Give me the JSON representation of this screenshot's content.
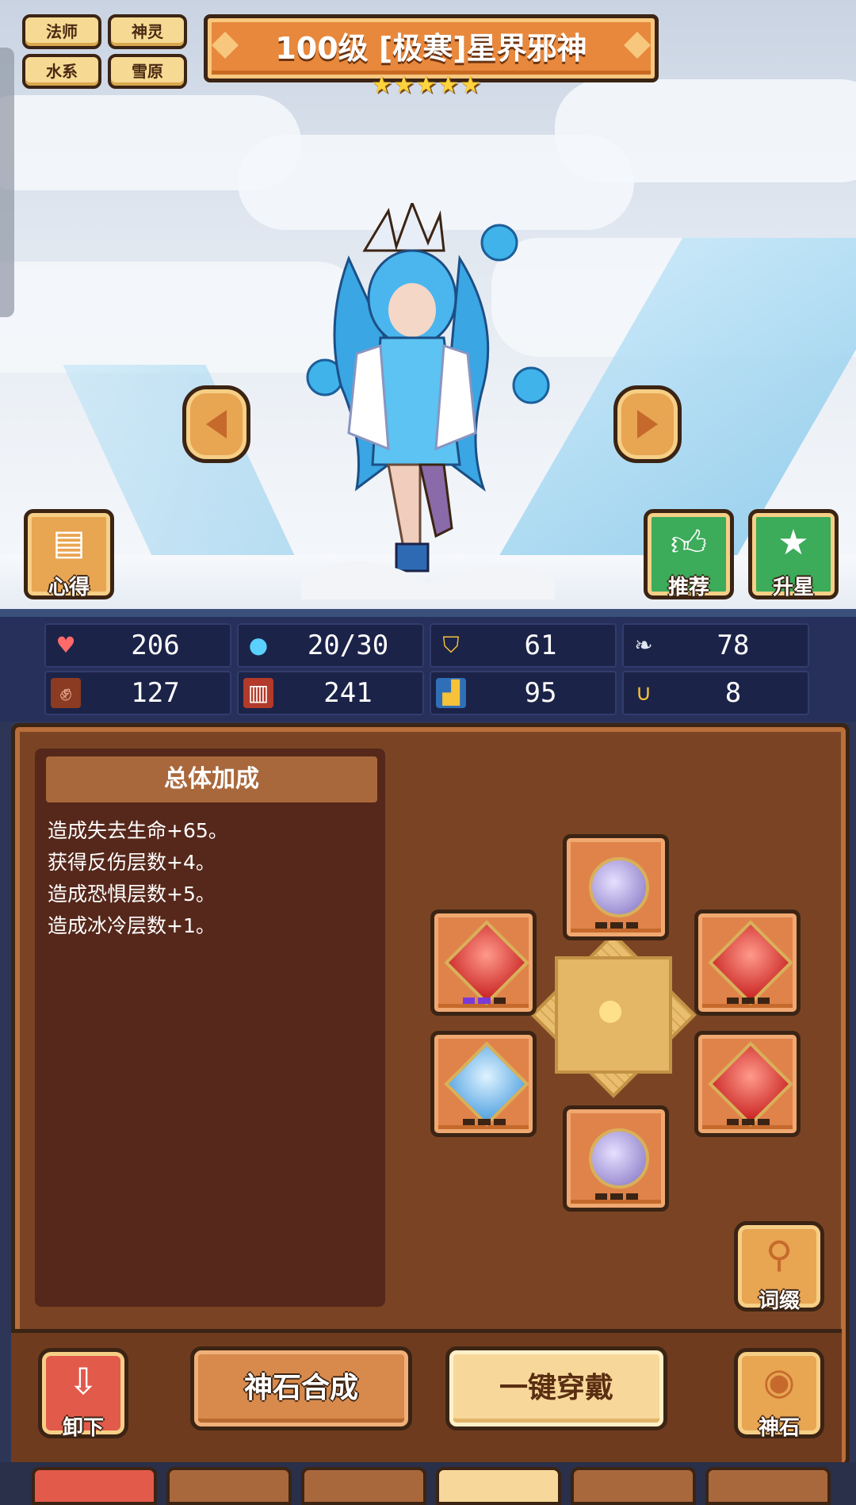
{
  "tags": [
    "法师",
    "神灵",
    "水系",
    "雪原"
  ],
  "hero": {
    "title": "100级 [极寒]星界邪神",
    "stars": 5
  },
  "side_buttons": {
    "notes": "心得",
    "recommend": "推荐",
    "star_up": "升星"
  },
  "stats": [
    {
      "icon": "heart-icon",
      "value": "206"
    },
    {
      "icon": "water-drop-icon",
      "value": "20/30"
    },
    {
      "icon": "shield-icon",
      "value": "61"
    },
    {
      "icon": "wing-icon",
      "value": "78"
    },
    {
      "icon": "fist-icon",
      "value": "127"
    },
    {
      "icon": "book-icon",
      "value": "241"
    },
    {
      "icon": "boot-icon",
      "value": "95"
    },
    {
      "icon": "horseshoe-icon",
      "value": "8"
    }
  ],
  "bonus": {
    "header": "总体加成",
    "lines": [
      "造成失去生命+65。",
      "获得反伤层数+4。",
      "造成恐惧层数+5。",
      "造成冰冷层数+1。"
    ]
  },
  "gem_slots": [
    {
      "gem": "purple-round-gem"
    },
    {
      "gem": "red-square-gem"
    },
    {
      "gem": "red-square-gem"
    },
    {
      "gem": "blue-square-gem"
    },
    {
      "gem": "red-square-gem"
    },
    {
      "gem": "purple-round-gem"
    }
  ],
  "actions": {
    "affix": "词缀",
    "unequip": "卸下",
    "synthesize": "神石合成",
    "equip_all": "一键穿戴",
    "godstone": "神石"
  },
  "colors": {
    "panel": "#7a4424",
    "panel_dark": "#56281b",
    "accent": "#e8883d",
    "stat_bg": "#1c2348"
  }
}
